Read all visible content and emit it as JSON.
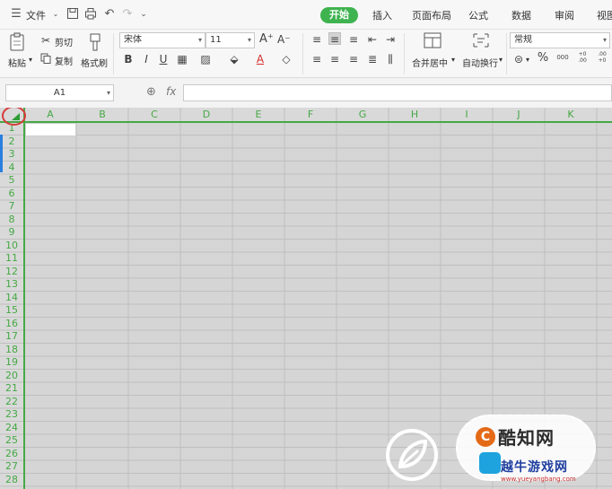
{
  "menu": {
    "hamburger_icon": "menu-icon",
    "file_label": "文件",
    "quick_access": [
      "save-icon",
      "print-icon",
      "undo-icon",
      "redo-icon",
      "customize-icon"
    ]
  },
  "tabs": [
    {
      "label": "开始",
      "active": true
    },
    {
      "label": "插入",
      "active": false
    },
    {
      "label": "页面布局",
      "active": false
    },
    {
      "label": "公式",
      "active": false
    },
    {
      "label": "数据",
      "active": false
    },
    {
      "label": "审阅",
      "active": false
    },
    {
      "label": "视图",
      "active": false
    }
  ],
  "ribbon": {
    "paste_label": "粘贴",
    "cut_label": "剪切",
    "copy_label": "复制",
    "format_painter_label": "格式刷",
    "font_name": "宋体",
    "font_size": "11",
    "font_grow": "A⁺",
    "font_shrink": "A⁻",
    "merge_center_label": "合并居中",
    "wrap_text_label": "自动换行",
    "number_format": "常规",
    "percent": "%",
    "thousands": "000",
    "inc_decimal": "+0 .00",
    "dec_decimal": ".00 +0"
  },
  "formula_bar": {
    "name_box_value": "A1",
    "fx_label": "fx",
    "formula_value": ""
  },
  "sheet": {
    "columns": [
      "A",
      "B",
      "C",
      "D",
      "E",
      "F",
      "G",
      "H",
      "I",
      "J",
      "K"
    ],
    "rows": [
      "1",
      "2",
      "3",
      "4",
      "5",
      "6",
      "7",
      "8",
      "9",
      "10",
      "11",
      "12",
      "13",
      "14",
      "15",
      "16",
      "17",
      "18",
      "19",
      "20",
      "21",
      "22",
      "23",
      "24",
      "25",
      "26",
      "27",
      "28"
    ],
    "selected_cell": "A1"
  },
  "watermark": {
    "title": "酷知网",
    "subtitle": "越牛游戏网",
    "url": "www.yueyangbang.com"
  },
  "colors": {
    "accent_green": "#3fb34f",
    "header_text_green": "#45a845",
    "highlight_ring": "#d83a3a",
    "sheet_background": "#d5d5d5"
  }
}
